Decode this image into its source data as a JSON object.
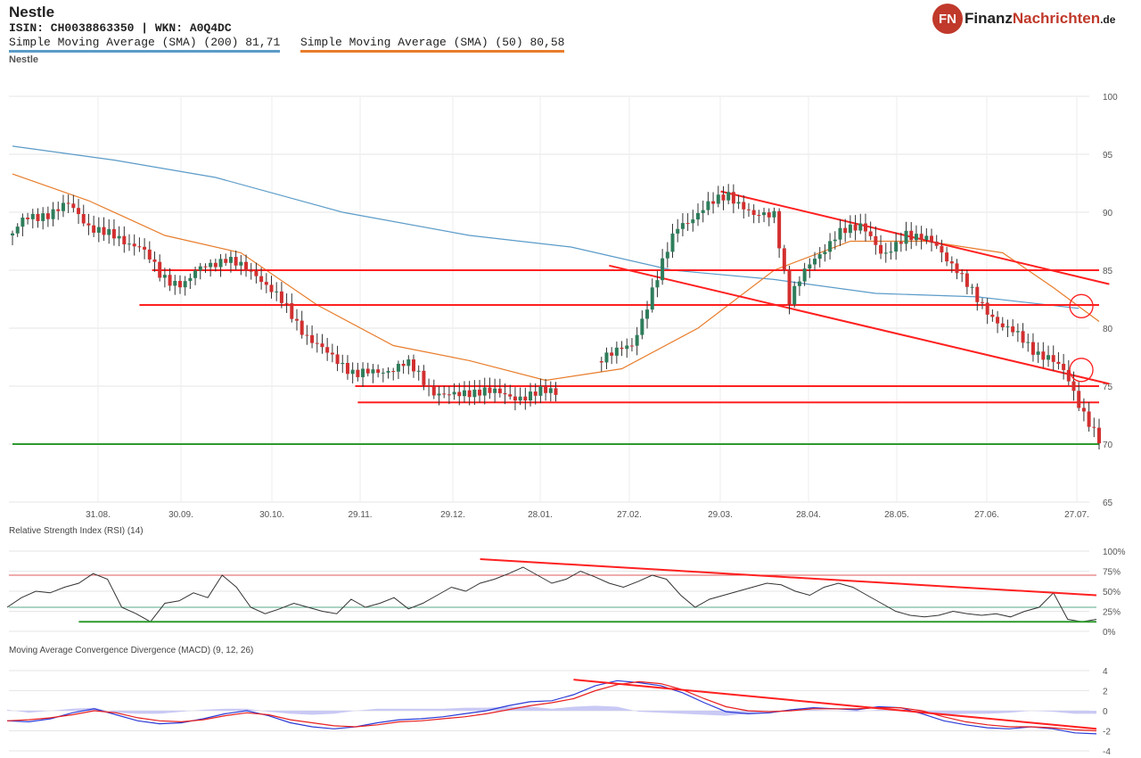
{
  "header": {
    "title": "Nestle",
    "isin_line": "ISIN: CH0038863350  | WKN: A0Q4DC",
    "sma200_label": "Simple Moving Average (SMA) (200) 81,71",
    "sma50_label": "Simple Moving Average (SMA) (50) 80,58",
    "subtitle": "Nestle"
  },
  "logo": {
    "badge": "FN",
    "text_dark": "Finanz",
    "text_red": "Nachrichten",
    "tld": ".de"
  },
  "colors": {
    "sma200": "#5b9bc8",
    "sma50": "#e87d2c",
    "up_candle": "#2e7d5b",
    "down_candle": "#d32f2f",
    "trendline": "#ff2020",
    "support": "#2e9a2e",
    "rsi_line": "#333333",
    "macd_line": "#2b3bd6",
    "signal_line": "#e82020",
    "histogram": "#c9c9f5"
  },
  "chart_data": [
    {
      "type": "candlestick",
      "title": "Nestle",
      "x_tick_labels": [
        "31.08.",
        "30.09.",
        "30.10.",
        "29.11.",
        "29.12.",
        "28.01.",
        "27.02.",
        "29.03.",
        "28.04.",
        "28.05.",
        "27.06.",
        "27.07."
      ],
      "y_ticks": [
        65,
        70,
        75,
        80,
        85,
        90,
        95,
        100
      ],
      "ylim": [
        65,
        100
      ],
      "grid": true,
      "close_path": [
        [
          0,
          88
        ],
        [
          5,
          89.3
        ],
        [
          12,
          90
        ],
        [
          22,
          90.5
        ],
        [
          30,
          88.8
        ],
        [
          40,
          88
        ],
        [
          50,
          87
        ],
        [
          58,
          84.5
        ],
        [
          68,
          84
        ],
        [
          74,
          85
        ],
        [
          84,
          86
        ],
        [
          96,
          84.8
        ],
        [
          105,
          82.3
        ],
        [
          115,
          79.8
        ],
        [
          125,
          77.5
        ],
        [
          135,
          76
        ],
        [
          145,
          76.4
        ],
        [
          155,
          76.8
        ],
        [
          165,
          74.8
        ],
        [
          175,
          74.1
        ],
        [
          185,
          74.6
        ],
        [
          195,
          74.3
        ],
        [
          205,
          74.1
        ],
        [
          215,
          74.6
        ],
        [
          225,
          76.5
        ],
        [
          235,
          77.8
        ],
        [
          244,
          78.4
        ],
        [
          252,
          83.5
        ],
        [
          262,
          88.5
        ],
        [
          272,
          90.5
        ],
        [
          282,
          91.5
        ],
        [
          292,
          89.5
        ],
        [
          300,
          90.2
        ],
        [
          306,
          82.3
        ],
        [
          315,
          85.8
        ],
        [
          325,
          88.2
        ],
        [
          335,
          89
        ],
        [
          343,
          85.8
        ],
        [
          352,
          88.5
        ],
        [
          362,
          87.2
        ],
        [
          372,
          85.2
        ],
        [
          380,
          82.5
        ],
        [
          390,
          80
        ],
        [
          398,
          79
        ],
        [
          408,
          77.5
        ],
        [
          415,
          75.8
        ],
        [
          420,
          73.5
        ],
        [
          425,
          71.5
        ],
        [
          428,
          70.3
        ]
      ],
      "sma200": [
        [
          0,
          95.7
        ],
        [
          40,
          94.5
        ],
        [
          80,
          93
        ],
        [
          130,
          90
        ],
        [
          180,
          88
        ],
        [
          220,
          87
        ],
        [
          260,
          85
        ],
        [
          300,
          84.2
        ],
        [
          340,
          83
        ],
        [
          380,
          82.7
        ],
        [
          420,
          81.71
        ]
      ],
      "sma50": [
        [
          0,
          93.3
        ],
        [
          30,
          91
        ],
        [
          60,
          88
        ],
        [
          90,
          86.5
        ],
        [
          120,
          82
        ],
        [
          150,
          78.5
        ],
        [
          180,
          77.2
        ],
        [
          210,
          75.5
        ],
        [
          240,
          76.5
        ],
        [
          270,
          80
        ],
        [
          300,
          85
        ],
        [
          330,
          87.5
        ],
        [
          360,
          87.5
        ],
        [
          390,
          86.5
        ],
        [
          410,
          83.5
        ],
        [
          428,
          80.58
        ]
      ],
      "horizontal_lines": [
        {
          "y": 85,
          "x_from": 55,
          "x_to": 428,
          "color": "red"
        },
        {
          "y": 82,
          "x_from": 50,
          "x_to": 428,
          "color": "red"
        },
        {
          "y": 75,
          "x_from": 135,
          "x_to": 428,
          "color": "red"
        },
        {
          "y": 73.6,
          "x_from": 136,
          "x_to": 428,
          "color": "red"
        },
        {
          "y": 70,
          "x_from": 0,
          "x_to": 428,
          "color": "green"
        }
      ],
      "trendlines": [
        {
          "from": [
            279,
            91.8
          ],
          "to": [
            432,
            83.8
          ]
        },
        {
          "from": [
            235,
            85.4
          ],
          "to": [
            432,
            75.2
          ]
        }
      ],
      "circles": [
        [
          421,
          81.9
        ],
        [
          421,
          76.4
        ]
      ]
    },
    {
      "type": "line",
      "title": "Relative Strength Index (RSI) (14)",
      "ylim": [
        0,
        100
      ],
      "tick_labels": [
        "0%",
        "25%",
        "50%",
        "75%",
        "100%"
      ],
      "levels": [
        70,
        30
      ],
      "values": [
        30,
        42,
        50,
        48,
        55,
        60,
        72,
        65,
        30,
        22,
        12,
        35,
        38,
        48,
        42,
        70,
        55,
        30,
        22,
        28,
        35,
        30,
        25,
        22,
        40,
        30,
        35,
        42,
        28,
        35,
        45,
        55,
        50,
        60,
        65,
        72,
        80,
        70,
        60,
        65,
        75,
        68,
        60,
        55,
        62,
        70,
        65,
        45,
        30,
        40,
        45,
        50,
        55,
        60,
        58,
        50,
        45,
        55,
        60,
        55,
        45,
        35,
        25,
        20,
        18,
        20,
        25,
        22,
        20,
        22,
        18,
        25,
        30,
        48,
        15,
        12,
        15
      ],
      "trendline": {
        "from": [
          33,
          90
        ],
        "to": [
          76,
          45
        ]
      },
      "support": {
        "y": 12,
        "x_from": 5,
        "x_to": 76
      }
    },
    {
      "type": "line",
      "title": "Moving Average Convergence Divergence (MACD) (9, 12, 26)",
      "ylim": [
        -4,
        4
      ],
      "tick_labels": [
        "4",
        "2",
        "0",
        "-2",
        "-4"
      ],
      "series": [
        {
          "values": [
            -1.0,
            -1.1,
            -0.8,
            -0.2,
            0.2,
            -0.4,
            -1.0,
            -1.3,
            -1.2,
            -0.8,
            -0.3,
            0.0,
            -0.5,
            -1.2,
            -1.6,
            -1.8,
            -1.6,
            -1.2,
            -0.9,
            -0.8,
            -0.6,
            -0.3,
            0.0,
            0.5,
            0.9,
            1.0,
            1.6,
            2.5,
            3.0,
            2.8,
            2.5,
            1.8,
            0.8,
            -0.1,
            -0.3,
            -0.2,
            0.1,
            0.3,
            0.2,
            0.1,
            0.4,
            0.3,
            -0.3,
            -1.0,
            -1.4,
            -1.7,
            -1.8,
            -1.6,
            -1.8,
            -2.2,
            -2.3
          ]
        },
        {
          "values": [
            -1.0,
            -0.9,
            -0.7,
            -0.4,
            0.0,
            -0.2,
            -0.7,
            -1.0,
            -1.1,
            -0.9,
            -0.5,
            -0.2,
            -0.4,
            -0.9,
            -1.2,
            -1.5,
            -1.6,
            -1.4,
            -1.1,
            -1.0,
            -0.8,
            -0.6,
            -0.3,
            0.1,
            0.5,
            0.8,
            1.2,
            2.0,
            2.6,
            2.9,
            2.7,
            2.1,
            1.2,
            0.4,
            0.0,
            -0.1,
            0.0,
            0.2,
            0.2,
            0.2,
            0.3,
            0.3,
            0.0,
            -0.6,
            -1.1,
            -1.4,
            -1.6,
            -1.6,
            -1.7,
            -1.9,
            -2.0
          ]
        }
      ],
      "histogram": [
        0.1,
        -0.2,
        0.0,
        0.2,
        0.3,
        -0.2,
        -0.3,
        -0.3,
        -0.1,
        0.1,
        0.2,
        0.2,
        -0.1,
        -0.3,
        -0.4,
        -0.3,
        0.0,
        0.2,
        0.2,
        0.2,
        0.2,
        0.3,
        0.3,
        0.4,
        0.4,
        0.2,
        0.4,
        0.5,
        0.4,
        -0.1,
        -0.2,
        -0.3,
        -0.4,
        -0.5,
        -0.3,
        -0.1,
        0.1,
        0.1,
        0.0,
        -0.1,
        0.1,
        0.0,
        -0.3,
        -0.4,
        -0.3,
        -0.3,
        -0.2,
        0.0,
        -0.1,
        -0.3,
        -0.3
      ],
      "trendline": {
        "from": [
          26,
          3.1
        ],
        "to": [
          50,
          -1.8
        ]
      }
    }
  ],
  "panels": {
    "rsi_title": "Relative Strength Index (RSI) (14)",
    "macd_title": "Moving Average Convergence Divergence (MACD) (9, 12, 26)"
  }
}
